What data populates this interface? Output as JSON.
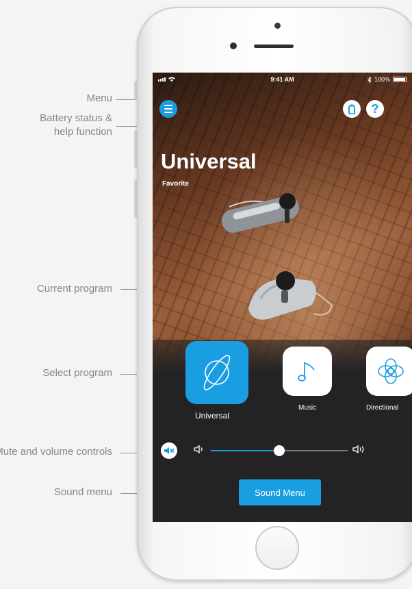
{
  "callouts": {
    "menu": "Menu",
    "battery_line1": "Battery status &",
    "battery_line2": "help function",
    "current_program": "Current program",
    "select_program": "Select program",
    "volume_controls": "Mute and volume controls",
    "sound_menu": "Sound menu"
  },
  "status_bar": {
    "time": "9:41 AM",
    "battery_text": "100%"
  },
  "program": {
    "title": "Universal",
    "subtitle": "Favorite"
  },
  "programs": [
    {
      "label": "Universal",
      "icon": "planet-icon",
      "selected": true
    },
    {
      "label": "Music",
      "icon": "music-note-icon",
      "selected": false
    },
    {
      "label": "Directional",
      "icon": "directional-icon",
      "selected": false
    }
  ],
  "volume": {
    "level": 0.5
  },
  "sound_button_label": "Sound Menu",
  "colors": {
    "accent": "#1a9ee2",
    "panel": "#232325"
  }
}
